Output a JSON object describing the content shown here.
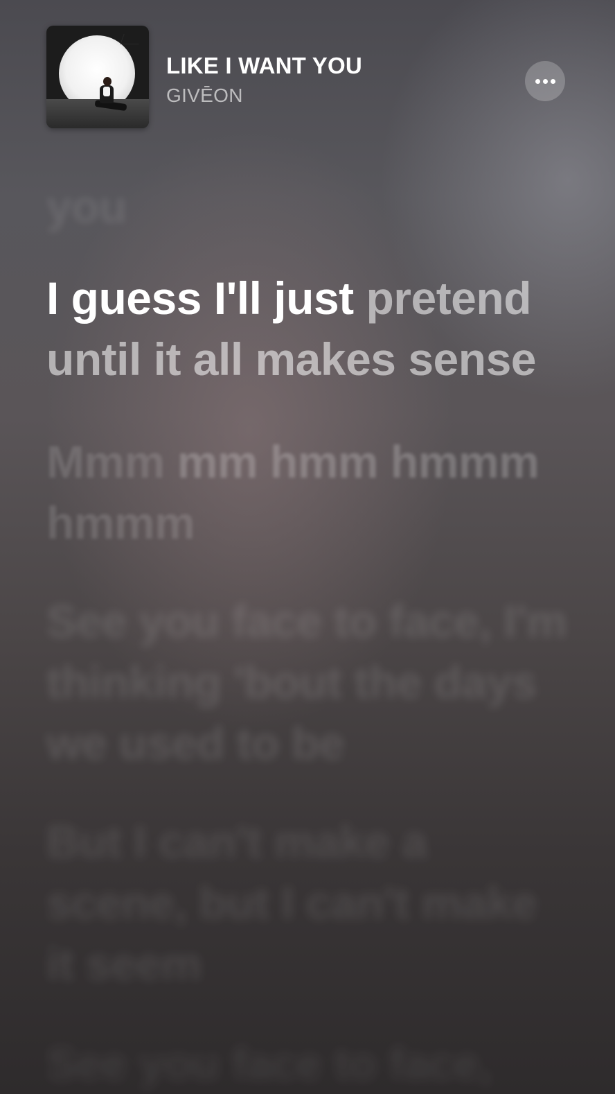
{
  "now_playing": {
    "title": "LIKE I WANT YOU",
    "artist": "GIVĒON",
    "more_icon": "ellipsis-icon"
  },
  "lyrics": {
    "previous": "you",
    "current": {
      "sung": "I guess I'll just",
      "upcoming": "pretend until it all makes sense"
    },
    "next1": {
      "part1": "Mmm",
      "part2": "mm hmm hmmm",
      "part3": "hmmm"
    },
    "next2": "See you face to face, I'm thinking 'bout the days we used to be",
    "next3": "But I can't make a scene, but I can't make it seem",
    "next4": "See you face to face,"
  },
  "colors": {
    "sung_text": "#ffffff",
    "unsung_text": "rgba(255,255,255,0.55)",
    "background_top": "#4b4a50",
    "background_bottom": "#2e2b2c"
  }
}
